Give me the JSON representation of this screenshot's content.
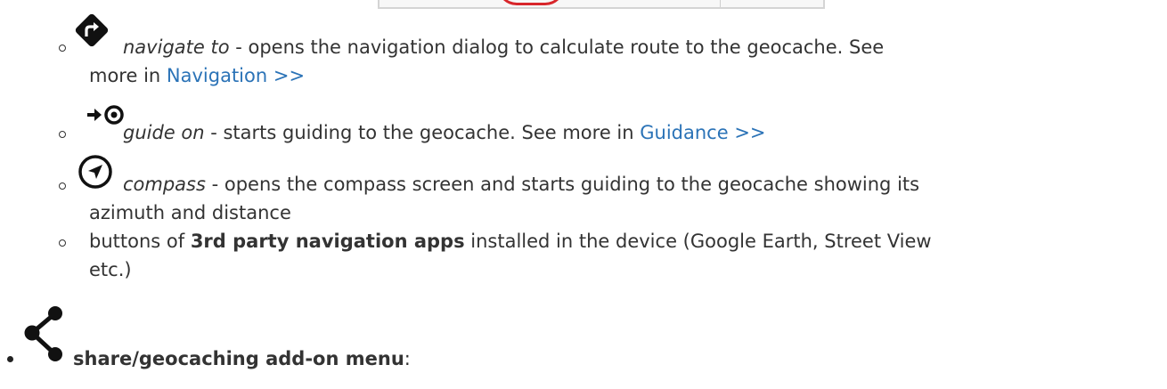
{
  "items": [
    {
      "term": "navigate to",
      "text1": " - opens the navigation dialog to calculate route to the geocache. See",
      "text2": "more in ",
      "link": "Navigation >>",
      "icon": "navigate-to-icon"
    },
    {
      "term": "guide on",
      "text1": " - starts guiding to the geocache. See more in ",
      "link": "Guidance >>",
      "icon": "guide-on-icon"
    },
    {
      "term": "compass",
      "text1": " - opens the compass screen and starts guiding to the geocache showing its",
      "text2": "azimuth and distance",
      "icon": "compass-icon"
    },
    {
      "pre": "buttons of ",
      "bold": "3rd party navigation apps",
      "text1": " installed in the device (Google Earth, Street View",
      "text2": "etc.)"
    }
  ],
  "share": {
    "label": "share/geocaching add-on menu",
    "suffix": ":",
    "icon": "share-icon"
  }
}
